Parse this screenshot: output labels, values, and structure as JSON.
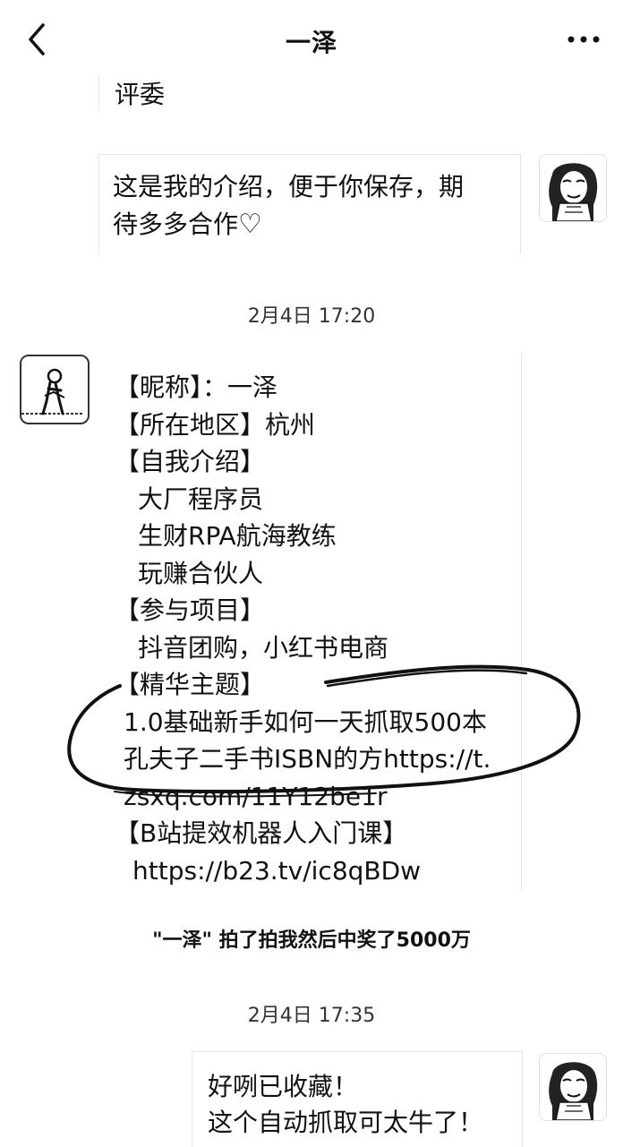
{
  "header": {
    "title": "一泽",
    "back_icon": "chevron-left-icon",
    "more_icon": "more-dots-icon"
  },
  "messages": {
    "m1_text": "评委",
    "m2_text": "这是我的介绍，便于你保存，期\n待多多合作",
    "m2_heart": "♡",
    "ts1": "2月4日 17:20",
    "profile_lines": {
      "nickname": "【昵称】：一泽",
      "region": "【所在地区】杭州",
      "intro_header": "【自我介绍】",
      "intro_1": "大厂程序员",
      "intro_2": "生财RPA航海教练",
      "intro_3": "玩赚合伙人",
      "projects_header": "【参与项目】",
      "projects_1": "抖音团购，小红书电商",
      "highlight_header": "【精华主题】",
      "highlight_1": "1.0基础新手如何一天抓取500本",
      "highlight_2": "孔夫子二手书ISBN的方https://t.",
      "highlight_3": "zsxq.com/11Y12be1r",
      "bili_header": "【B站提效机器人入门课】",
      "bili_link": "https://b23.tv/ic8qBDw"
    },
    "system_note": "\"一泽\" 拍了拍我然后中奖了5000万",
    "ts2": "2月4日 17:35",
    "m3_line1": "好咧已收藏！",
    "m3_line2": "这个自动抓取可太牛了！"
  },
  "colors": {
    "text": "#111111",
    "bubble_edge": "#e4e4e4",
    "annotation_ink": "#111111"
  }
}
